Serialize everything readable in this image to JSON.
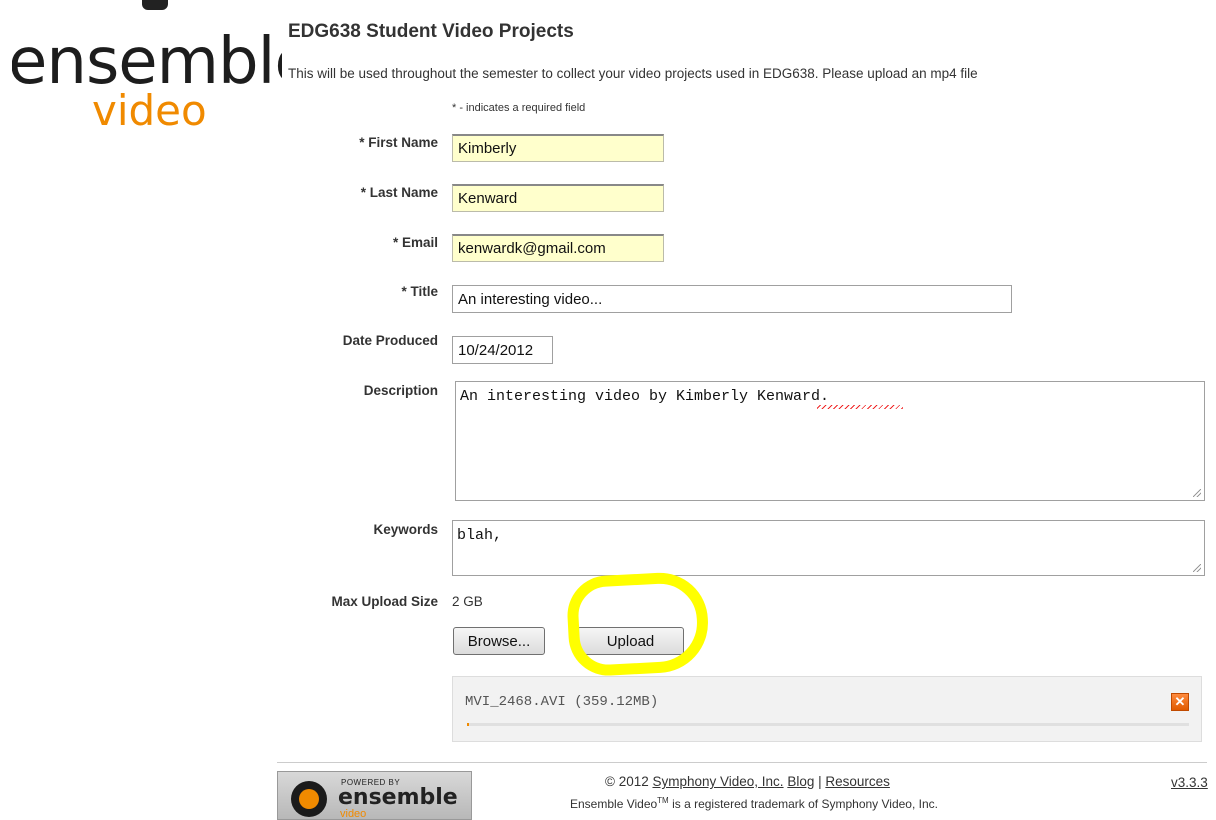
{
  "logo": {
    "word1": "ensemble",
    "word2": "video",
    "accent": "#f08a00"
  },
  "page": {
    "title": "EDG638 Student Video Projects",
    "intro": "This will be used throughout the semester to collect your video projects used in EDG638. Please upload an mp4 file",
    "required_note": "* - indicates a required field"
  },
  "form": {
    "first_name": {
      "label": "* First Name",
      "value": "Kimberly"
    },
    "last_name": {
      "label": "* Last Name",
      "value": "Kenward"
    },
    "email": {
      "label": "* Email",
      "value": "kenwardk@gmail.com"
    },
    "title": {
      "label": "* Title",
      "value": "An interesting video..."
    },
    "date_produced": {
      "label": "Date Produced",
      "value": "10/24/2012"
    },
    "description": {
      "label": "Description",
      "value": "An interesting video by Kimberly Kenward."
    },
    "keywords": {
      "label": "Keywords",
      "value": "blah,"
    },
    "max_upload": {
      "label": "Max Upload Size",
      "value": "2 GB"
    },
    "required_bg": "#ffffcc"
  },
  "buttons": {
    "browse": "Browse...",
    "upload": "Upload"
  },
  "upload_queue": {
    "file": "MVI_2468.AVI (359.12MB)",
    "remove_icon": "close-icon",
    "remove_glyph": "✕",
    "progress": 0.003
  },
  "annotation": {
    "color": "#ffff00"
  },
  "footer": {
    "badge_powered": "POWERED BY",
    "badge_brand": "ensemble",
    "badge_sub": "video",
    "copyright_prefix": "© 2012 ",
    "company_link": "Symphony Video, Inc.",
    "blog_link": "Blog",
    "separator": " | ",
    "resources_link": "Resources",
    "trademark_prefix": "Ensemble Video",
    "trademark_sup": "TM",
    "trademark_suffix": " is a registered trademark of Symphony Video, Inc.",
    "version": "v3.3.3"
  }
}
